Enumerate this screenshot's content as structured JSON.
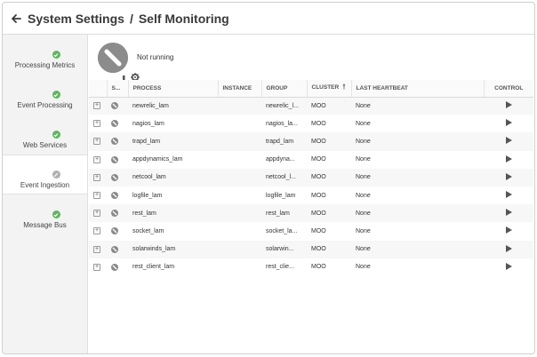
{
  "header": {
    "back_icon": "arrow-left-icon",
    "title_parent": "System Settings",
    "separator": "/",
    "title_current": "Self Monitoring"
  },
  "sidebar": {
    "items": [
      {
        "label": "Processing Metrics",
        "icon": "metrics-gear-icon",
        "status": "ok",
        "active": false
      },
      {
        "label": "Event Processing",
        "icon": "event-processing-icon",
        "status": "ok",
        "active": false
      },
      {
        "label": "Web Services",
        "icon": "web-services-grid-icon",
        "status": "ok",
        "active": false
      },
      {
        "label": "Event Ingestion",
        "icon": "event-ingestion-icon",
        "status": "off",
        "active": true
      },
      {
        "label": "Message Bus",
        "icon": "message-bus-arrows-icon",
        "status": "ok",
        "active": false
      }
    ]
  },
  "status": {
    "icon": "not-running-icon",
    "text": "Not running"
  },
  "table": {
    "columns": [
      "",
      "S...",
      "PROCESS",
      "INSTANCE",
      "GROUP",
      "CLUSTER",
      "LAST HEARTBEAT",
      "CONTROL"
    ],
    "sort_icon": "sort-up-arrow-icon",
    "rows": [
      {
        "process": "newrelic_lam",
        "instance": "",
        "group": "newrelic_l...",
        "cluster": "MOO",
        "heartbeat": "None"
      },
      {
        "process": "nagios_lam",
        "instance": "",
        "group": "nagios_la...",
        "cluster": "MOO",
        "heartbeat": "None"
      },
      {
        "process": "trapd_lam",
        "instance": "",
        "group": "trapd_lam",
        "cluster": "MOO",
        "heartbeat": "None"
      },
      {
        "process": "appdynamics_lam",
        "instance": "",
        "group": "appdyna...",
        "cluster": "MOO",
        "heartbeat": "None"
      },
      {
        "process": "netcool_lam",
        "instance": "",
        "group": "netcool_l...",
        "cluster": "MOO",
        "heartbeat": "None"
      },
      {
        "process": "logfile_lam",
        "instance": "",
        "group": "logfile_lam",
        "cluster": "MOO",
        "heartbeat": "None"
      },
      {
        "process": "rest_lam",
        "instance": "",
        "group": "rest_lam",
        "cluster": "MOO",
        "heartbeat": "None"
      },
      {
        "process": "socket_lam",
        "instance": "",
        "group": "socket_la...",
        "cluster": "MOO",
        "heartbeat": "None"
      },
      {
        "process": "solarwinds_lam",
        "instance": "",
        "group": "solarwin...",
        "cluster": "MOO",
        "heartbeat": "None"
      },
      {
        "process": "rest_client_lam",
        "instance": "",
        "group": "rest_clie...",
        "cluster": "MOO",
        "heartbeat": "None"
      }
    ]
  }
}
